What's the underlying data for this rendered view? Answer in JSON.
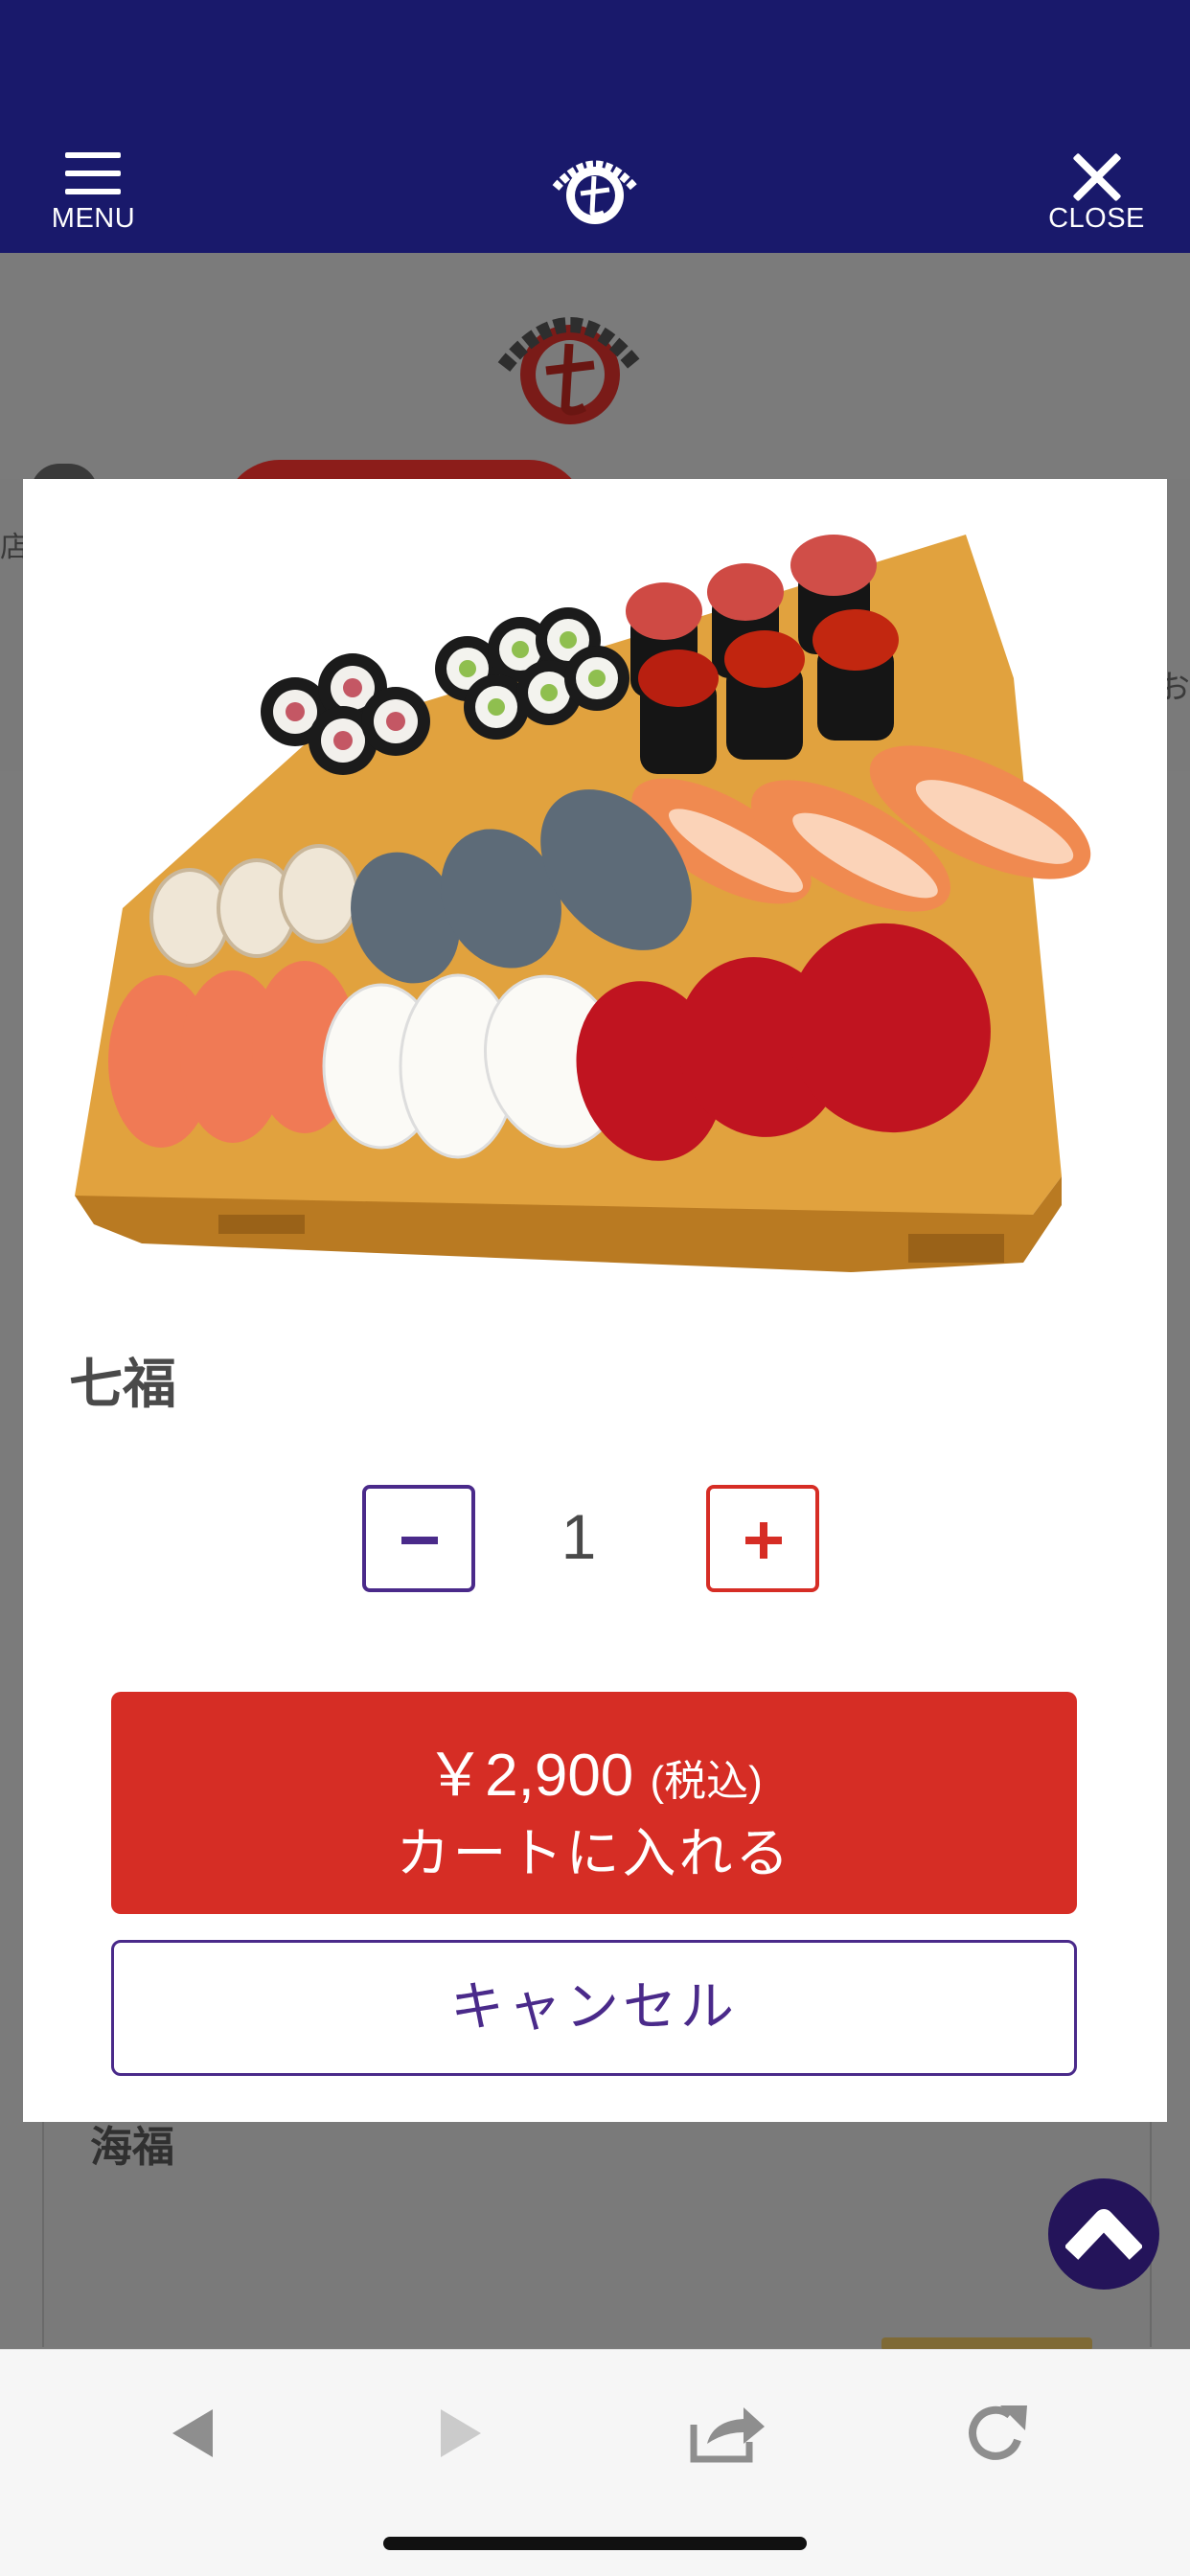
{
  "header": {
    "menu_label": "MENU",
    "close_label": "CLOSE",
    "logo_icon": "shop-emblem-icon",
    "colors": {
      "header_bg": "#19196b"
    }
  },
  "background": {
    "left_edge_text": "店",
    "right_edge_text": "お",
    "card_title": "海福"
  },
  "modal": {
    "product_name": "七福",
    "quantity": "1",
    "price": "￥2,900",
    "tax_note": "(税込)",
    "add_to_cart_label": "カートに入れる",
    "cancel_label": "キャンセル",
    "colors": {
      "accent_red": "#d62d25",
      "accent_purple": "#4a2a8a"
    }
  },
  "browser": {
    "icons": [
      "back-icon",
      "forward-icon",
      "share-icon",
      "reload-icon"
    ]
  }
}
